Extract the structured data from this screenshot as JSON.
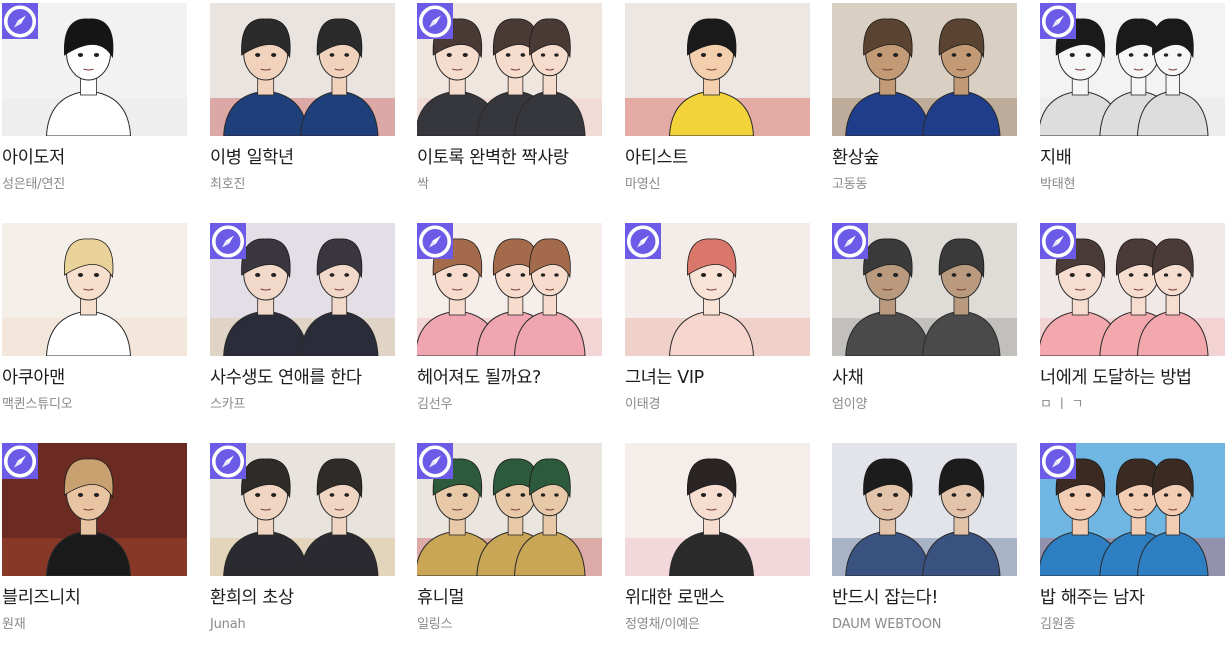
{
  "badge_icon": "compass-icon",
  "badge_color": "#6b5be6",
  "webtoons": [
    {
      "title": "아이도저",
      "author": "성은태/연진",
      "badge": true,
      "thumb_bg": "#f2f2f2",
      "accent": "#e8e8e8",
      "hair": "#151515",
      "skin": "#ffffff",
      "cloth": "#ffffff"
    },
    {
      "title": "이병 일학년",
      "author": "최호진",
      "badge": false,
      "thumb_bg": "#e9e4e0",
      "accent": "#c23a3a",
      "hair": "#2b2b2b",
      "skin": "#f1d3bd",
      "cloth": "#1f3f7a"
    },
    {
      "title": "이토록 완벽한 짝사랑",
      "author": "싹",
      "badge": true,
      "thumb_bg": "#efe6e0",
      "accent": "#f3c7c2",
      "hair": "#4a3a36",
      "skin": "#f6dccd",
      "cloth": "#36373d"
    },
    {
      "title": "아티스트",
      "author": "마영신",
      "badge": false,
      "thumb_bg": "#ece7e2",
      "accent": "#d63a32",
      "hair": "#1a1a1a",
      "skin": "#f4cfae",
      "cloth": "#f3d33a"
    },
    {
      "title": "환상숲",
      "author": "고동동",
      "badge": false,
      "thumb_bg": "#d9cfc3",
      "accent": "#8a6a4a",
      "hair": "#5a4330",
      "skin": "#c39a76",
      "cloth": "#1f3d8a"
    },
    {
      "title": "지배",
      "author": "박태현",
      "badge": true,
      "thumb_bg": "#f3f3f3",
      "accent": "#e1e1e1",
      "hair": "#1a1a1a",
      "skin": "#f6f6f6",
      "cloth": "#dddddd"
    },
    {
      "title": "아쿠아맨",
      "author": "맥퀸스튜디오",
      "badge": false,
      "thumb_bg": "#f5efe9",
      "accent": "#f1d9c6",
      "hair": "#e9d39a",
      "skin": "#f7dfcd",
      "cloth": "#ffffff"
    },
    {
      "title": "사수생도 연애를 한다",
      "author": "스카프",
      "badge": true,
      "thumb_bg": "#e4dfe6",
      "accent": "#d9c08a",
      "hair": "#3a3640",
      "skin": "#f1d8c9",
      "cloth": "#2b2c3a"
    },
    {
      "title": "헤어져도 될까요?",
      "author": "김선우",
      "badge": true,
      "thumb_bg": "#f6eeea",
      "accent": "#f0a6b1",
      "hair": "#a46a4c",
      "skin": "#f7dccd",
      "cloth": "#f0a6b1"
    },
    {
      "title": "그녀는 VIP",
      "author": "이태경",
      "badge": true,
      "thumb_bg": "#f4ece8",
      "accent": "#e7a08e",
      "hair": "#d9776a",
      "skin": "#f9e2d6",
      "cloth": "#f7d6cd"
    },
    {
      "title": "사채",
      "author": "엄이양",
      "badge": true,
      "thumb_bg": "#dfdcd8",
      "accent": "#8c8c8c",
      "hair": "#3a3a3a",
      "skin": "#b99a7e",
      "cloth": "#4a4a4a"
    },
    {
      "title": "너에게 도달하는 방법",
      "author": "ㅁ ㅣ ㄱ",
      "badge": true,
      "thumb_bg": "#f1e9e7",
      "accent": "#f3a8ad",
      "hair": "#4a3b38",
      "skin": "#f7ddd0",
      "cloth": "#f3a8ad"
    },
    {
      "title": "블리즈니치",
      "author": "원재",
      "badge": true,
      "thumb_bg": "#6b2a22",
      "accent": "#c0522e",
      "hair": "#c9a070",
      "skin": "#e8c4a3",
      "cloth": "#1a1a1a"
    },
    {
      "title": "환희의 초상",
      "author": "Junah",
      "badge": true,
      "thumb_bg": "#e8e3dd",
      "accent": "#d9b97a",
      "hair": "#2f2b29",
      "skin": "#f0d6c2",
      "cloth": "#2a2a30"
    },
    {
      "title": "휴니멀",
      "author": "일링스",
      "badge": true,
      "thumb_bg": "#eae5df",
      "accent": "#c63e3e",
      "hair": "#2d5a3a",
      "skin": "#e7c9a8",
      "cloth": "#c9a556"
    },
    {
      "title": "위대한 로맨스",
      "author": "정영채/이예은",
      "badge": false,
      "thumb_bg": "#f4ede9",
      "accent": "#f1b2c3",
      "hair": "#2a2424",
      "skin": "#f7ddd0",
      "cloth": "#2a2a2a"
    },
    {
      "title": "반드시 잡는다!",
      "author": "DAUM WEBTOON",
      "badge": false,
      "thumb_bg": "#e2e4ea",
      "accent": "#3c5a8a",
      "hair": "#1c1c1c",
      "skin": "#e2c4aa",
      "cloth": "#3a5280"
    },
    {
      "title": "밥 해주는 남자",
      "author": "김원종",
      "badge": true,
      "thumb_bg": "#6fb7e2",
      "accent": "#d84a4a",
      "hair": "#3a2a22",
      "skin": "#f3cdb3",
      "cloth": "#2d7fc1"
    }
  ]
}
